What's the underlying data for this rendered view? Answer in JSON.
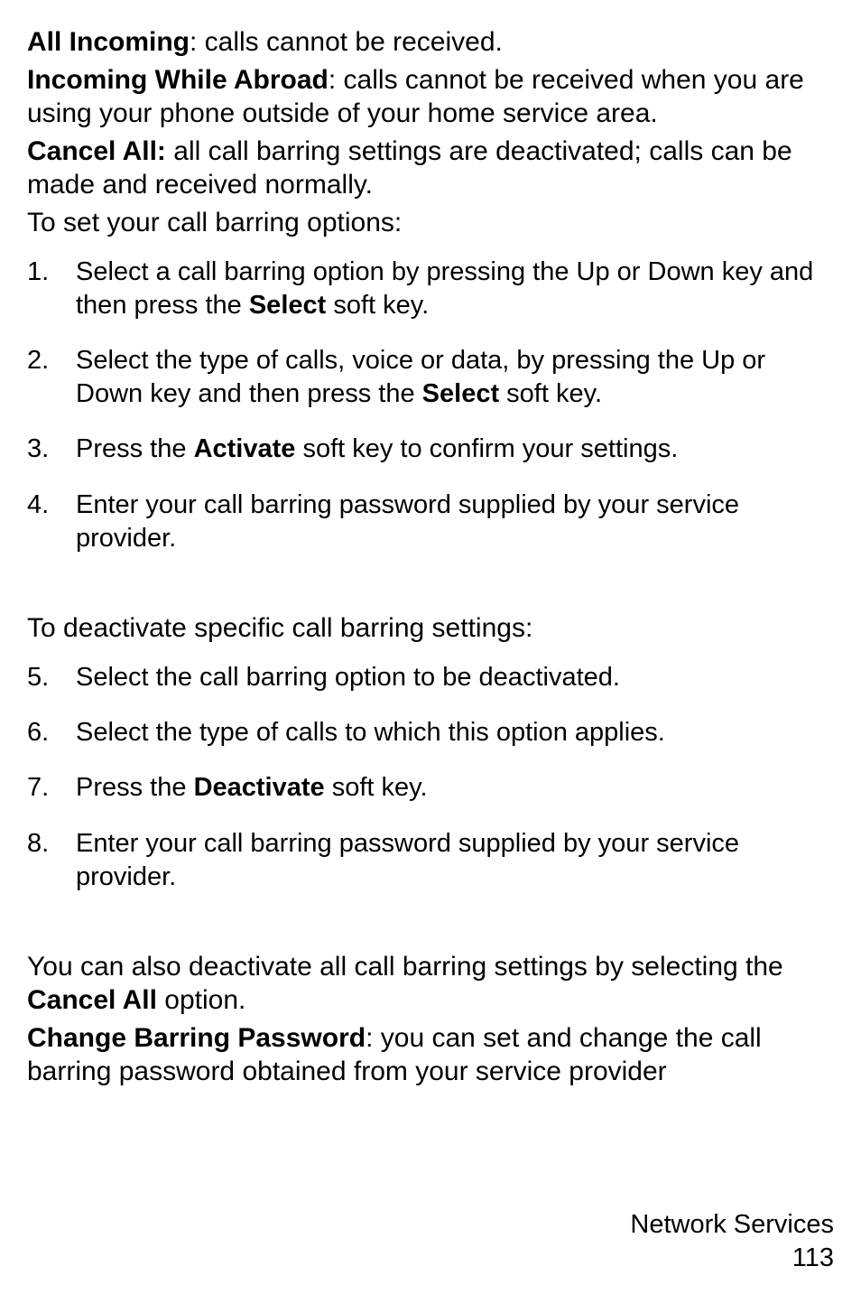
{
  "para1_bold": "All Incoming",
  "para1_rest": ": calls cannot be received.",
  "para2_bold": "Incoming While Abroad",
  "para2_rest": ": calls cannot be received when you are using your phone outside of your home service area.",
  "para3_bold": "Cancel All:",
  "para3_rest": " all call barring settings are deactivated; calls can be made and received normally.",
  "para4": "To set your call barring options:",
  "list1": {
    "item1_num": "1.",
    "item1_a": "Select a call barring option by pressing the Up or Down key and then press the ",
    "item1_bold": "Select",
    "item1_b": " soft key.",
    "item2_num": "2.",
    "item2_a": "Select the type of calls, voice or data, by pressing the Up or Down key and then press the ",
    "item2_bold": "Select",
    "item2_b": " soft key.",
    "item3_num": "3.",
    "item3_a": "Press the ",
    "item3_bold": "Activate",
    "item3_b": " soft key to confirm your settings.",
    "item4_num": "4.",
    "item4_a": "Enter your call barring password supplied by your service provider."
  },
  "para5": "To deactivate specific call barring settings:",
  "list2": {
    "item5_num": "5.",
    "item5_a": "Select the call barring option to be deactivated.",
    "item6_num": "6.",
    "item6_a": "Select the type of calls to which this option applies.",
    "item7_num": "7.",
    "item7_a": "Press the ",
    "item7_bold": "Deactivate",
    "item7_b": " soft key.",
    "item8_num": "8.",
    "item8_a": "Enter your call barring password supplied by your service provider."
  },
  "para6_a": "You can also deactivate all call barring settings by selecting the ",
  "para6_bold": "Cancel All",
  "para6_b": " option.",
  "para7_bold": "Change Barring Password",
  "para7_rest": ": you can set and change the call barring password obtained from your service provider",
  "footer_section": "Network Services",
  "footer_page": "113"
}
